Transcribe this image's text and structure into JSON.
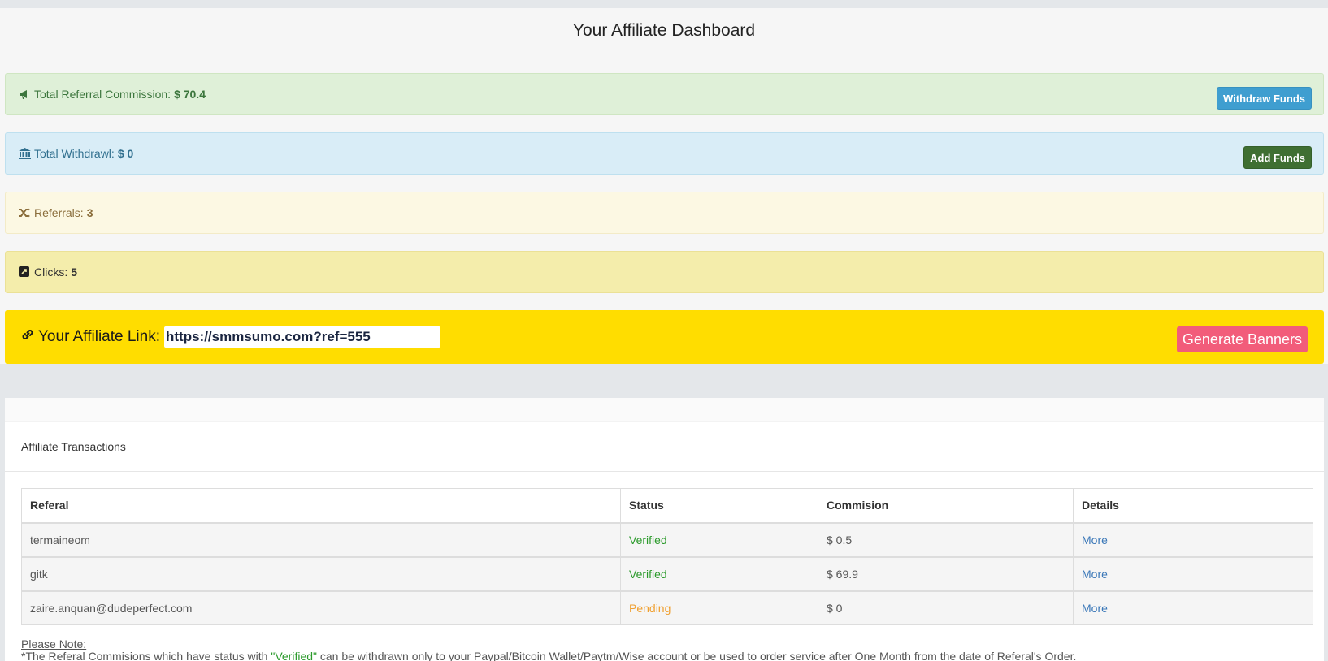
{
  "page": {
    "title": "Your Affiliate Dashboard"
  },
  "stats": {
    "commission": {
      "label": "Total Referral Commission:",
      "value": "$ 70.4",
      "icon": "bullhorn-icon",
      "button": "Withdraw Funds"
    },
    "withdrawl": {
      "label": "Total Withdrawl:",
      "value": "$ 0",
      "icon": "bank-icon",
      "button": "Add Funds"
    },
    "referrals": {
      "label": "Referrals:",
      "value": "3",
      "icon": "random-icon"
    },
    "clicks": {
      "label": "Clicks:",
      "value": "5",
      "icon": "external-link-icon"
    }
  },
  "affiliate_link": {
    "label": "Your Affiliate Link:",
    "value": "https://smmsumo.com?ref=555",
    "icon": "link-icon",
    "button": "Generate Banners"
  },
  "transactions": {
    "heading": "Affiliate Transactions",
    "columns": [
      "Referal",
      "Status",
      "Commision",
      "Details"
    ],
    "rows": [
      {
        "referal": "termaineom",
        "status": "Verified",
        "commision": "$ 0.5",
        "details": "More"
      },
      {
        "referal": "gitk",
        "status": "Verified",
        "commision": "$ 69.9",
        "details": "More"
      },
      {
        "referal": "zaire.anquan@dudeperfect.com",
        "status": "Pending",
        "commision": "$ 0",
        "details": "More"
      }
    ],
    "note_title": "Please Note:",
    "note_prefix": "*The Referal Commisions which have status with ",
    "note_highlight": "\"Verified\"",
    "note_suffix": " can be withdrawn only to your Paypal/Bitcoin Wallet/Paytm/Wise account or be used to order service after One Month from the date of Referal's Order."
  },
  "colors": {
    "commission_bg": "#dff0d8",
    "withdrawl_bg": "#d9edf7",
    "referrals_bg": "#fcf8e3",
    "clicks_bg": "#f4edab",
    "link_bg": "#ffdd00",
    "banners_button": "#f25c7a",
    "verified": "#2b9a2b",
    "pending": "#f0a030"
  }
}
